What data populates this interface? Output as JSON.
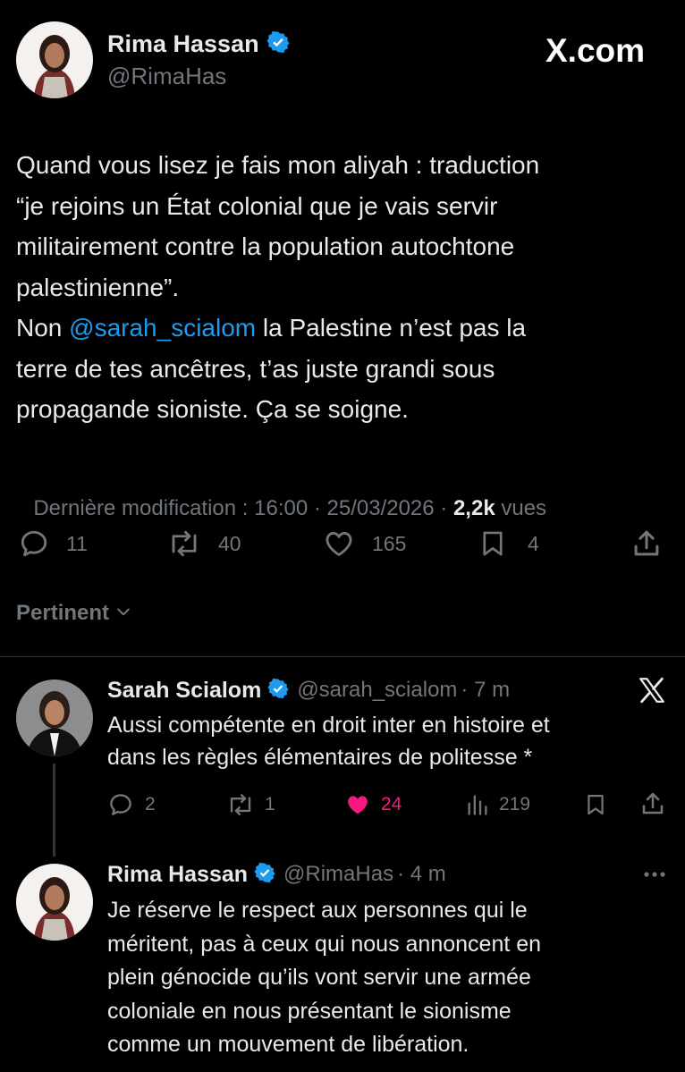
{
  "main_tweet": {
    "author_name": "Rima Hassan",
    "author_handle": "@RimaHas",
    "brand": "X.com",
    "text_lines": [
      "Quand vous lisez je fais mon aliyah : traduction",
      "“je rejoins un État colonial que je vais servir",
      "militairement contre la population autochtone",
      "palestinienne”."
    ],
    "line5_prefix": "Non ",
    "line5_mention": "@sarah_scialom",
    "line5_suffix": " la Palestine n’est pas la",
    "text_lines_end": [
      "terre de tes ancêtres, t’as juste grandi sous",
      "propagande sioniste. Ça se soigne."
    ],
    "meta_prefix": "Dernière modification : 16:00 · 25/03/2026",
    "meta_sep": " · ",
    "views_count": "2,2k",
    "views_label": " vues",
    "replies": "11",
    "reposts": "40",
    "likes": "165",
    "bookmarks": "4"
  },
  "sort": {
    "label": "Pertinent"
  },
  "reply1": {
    "author_name": "Sarah Scialom",
    "author_handle": "@sarah_scialom",
    "time": "· 7 m",
    "text_lines": [
      "Aussi compétente en droit inter en histoire et",
      "dans les règles élémentaires de politesse *"
    ],
    "replies": "2",
    "reposts": "1",
    "likes": "24",
    "views": "219"
  },
  "reply2": {
    "author_name": "Rima Hassan",
    "author_handle": "@RimaHas",
    "time": "· 4 m",
    "text_lines": [
      "Je réserve le respect aux personnes qui le",
      "méritent, pas à ceux qui nous annoncent en",
      "plein génocide qu’ils vont servir une armée",
      "coloniale en nous présentant le sionisme",
      "comme un mouvement de libération."
    ]
  },
  "colors": {
    "accent": "#1d9bf0",
    "like": "#f91880",
    "muted": "#71767b",
    "text": "#e7e9ea"
  }
}
